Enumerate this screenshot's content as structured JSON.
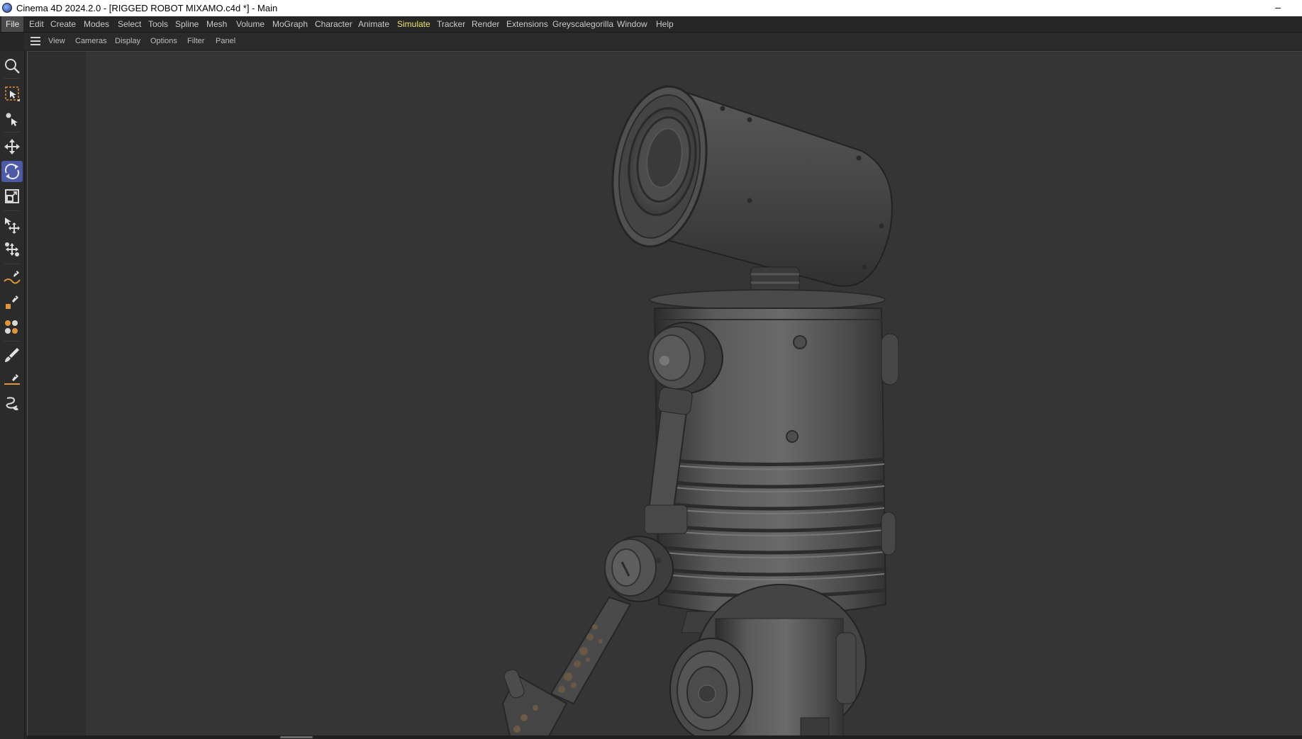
{
  "window": {
    "title": "Cinema 4D 2024.2.0 - [RIGGED ROBOT MIXAMO.c4d *] - Main",
    "minimize_glyph": "–"
  },
  "menubar": {
    "items": [
      "File",
      "Edit",
      "Create",
      "Modes",
      "Select",
      "Tools",
      "Spline",
      "Mesh",
      "Volume",
      "MoGraph",
      "Character",
      "Animate",
      "Simulate",
      "Tracker",
      "Render",
      "Extensions",
      "Greyscalegorilla",
      "Window",
      "Help"
    ]
  },
  "viewport_menu": {
    "items": [
      "View",
      "Cameras",
      "Display",
      "Options",
      "Filter",
      "Panel"
    ]
  },
  "toolbar": {
    "tools": [
      "search-icon",
      "live-selection-icon",
      "tweak-icon",
      "move-icon",
      "rotate-icon",
      "scale-icon",
      "transfer-icon",
      "axis-move-icon",
      "spline-pen-icon",
      "spline-sketch-icon",
      "spline-smooth-icon",
      "brush-icon",
      "spline-arc-icon",
      "knife-icon"
    ],
    "active_tool": "rotate-icon"
  },
  "colors": {
    "accent_active": "#4d5aa6",
    "simulate_highlight": "#e9e36a",
    "tool_orange": "#e0953a"
  }
}
